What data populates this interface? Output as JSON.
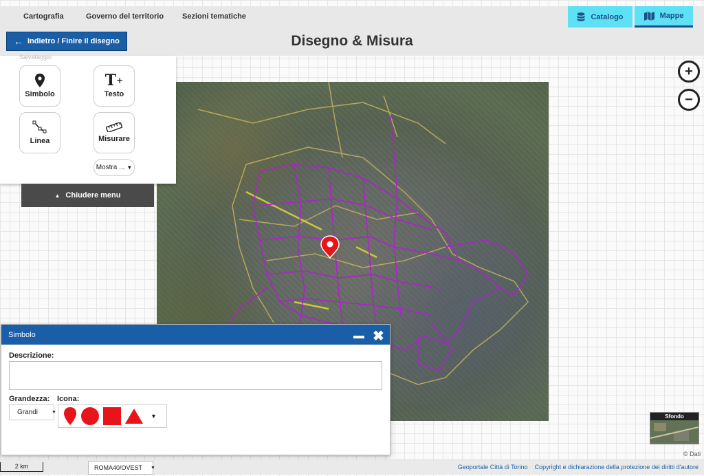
{
  "nav": {
    "items": [
      "Cartografia",
      "Governo del territorio",
      "Sezioni tematiche"
    ]
  },
  "header_buttons": {
    "catalog": "Catalogo",
    "maps": "Mappe"
  },
  "back_button": "Indietro / Finire il disegno",
  "title": "Disegno & Misura",
  "tools": {
    "save_label": "Salvataggio",
    "items": [
      {
        "label": "Simbolo",
        "icon": "map-pin-icon"
      },
      {
        "label": "Testo",
        "icon": "text-add-icon"
      },
      {
        "label": "Linea",
        "icon": "line-icon"
      },
      {
        "label": "Misurare",
        "icon": "ruler-icon"
      }
    ],
    "more": "Mostra ..."
  },
  "close_menu": "Chiudere menu",
  "basemap": {
    "label": "Sfondo"
  },
  "attribution": "© Dati",
  "dialog": {
    "title": "Simbolo",
    "description_label": "Descrizione:",
    "size_label": "Grandezza:",
    "icon_label": "Icona:",
    "size_value": "Grandi",
    "icon_options": [
      "marker-icon",
      "circle-icon",
      "square-icon",
      "triangle-icon"
    ],
    "icon_color": "#e8141a"
  },
  "footer": {
    "scale": "2 km",
    "projection": "ROMA40/OVEST",
    "links": [
      "Geoportale Città di Torino",
      "Copyright e dichiarazione della protezione dei diritti d'autore"
    ]
  },
  "colors": {
    "primary": "#1a5ea8",
    "accent": "#5ee0f5",
    "district_lines": "#a020c0",
    "boundary_lines": "#c8b45a"
  }
}
